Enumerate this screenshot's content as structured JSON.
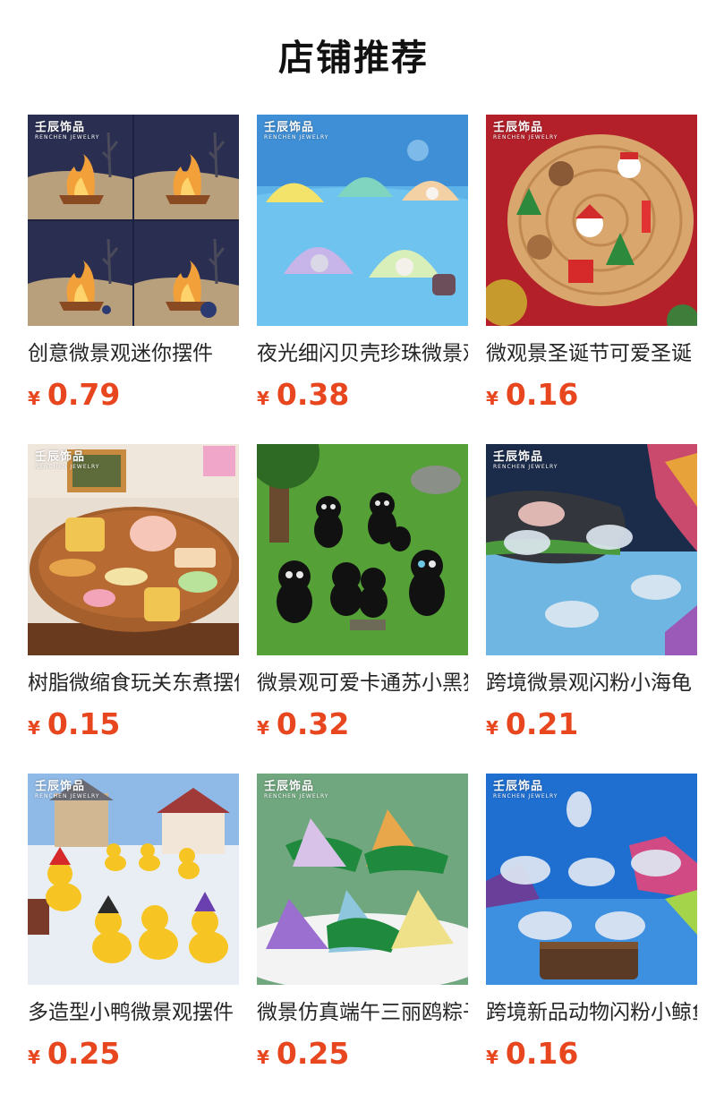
{
  "section_title": "店铺推荐",
  "watermark": {
    "brand": "壬辰饰品",
    "sub": "RENCHEN JEWELRY"
  },
  "products": [
    {
      "name": "创意微景观迷你摆件",
      "currency": "¥",
      "price": "0.79",
      "image": "campfire-miniatures"
    },
    {
      "name": "夜光细闪贝壳珍珠微景观",
      "currency": "¥",
      "price": "0.38",
      "image": "glowing-shell-pearls"
    },
    {
      "name": "微观景圣诞节可爱圣诞",
      "currency": "¥",
      "price": "0.16",
      "image": "christmas-figurines-on-wood"
    },
    {
      "name": "树脂微缩食玩关东煮摆件",
      "currency": "¥",
      "price": "0.15",
      "image": "resin-mini-food"
    },
    {
      "name": "微景观可爱卡通苏小黑猫",
      "currency": "¥",
      "price": "0.32",
      "image": "black-cat-figures"
    },
    {
      "name": "跨境微景观闪粉小海龟",
      "currency": "¥",
      "price": "0.21",
      "image": "glitter-sea-turtles"
    },
    {
      "name": "多造型小鸭微景观摆件",
      "currency": "¥",
      "price": "0.25",
      "image": "yellow-ducks-snow-village"
    },
    {
      "name": "微景仿真端午三丽鸥粽子",
      "currency": "¥",
      "price": "0.25",
      "image": "zongzi-resin-pieces"
    },
    {
      "name": "跨境新品动物闪粉小鲸鱼",
      "currency": "¥",
      "price": "0.16",
      "image": "glitter-whales"
    }
  ]
}
